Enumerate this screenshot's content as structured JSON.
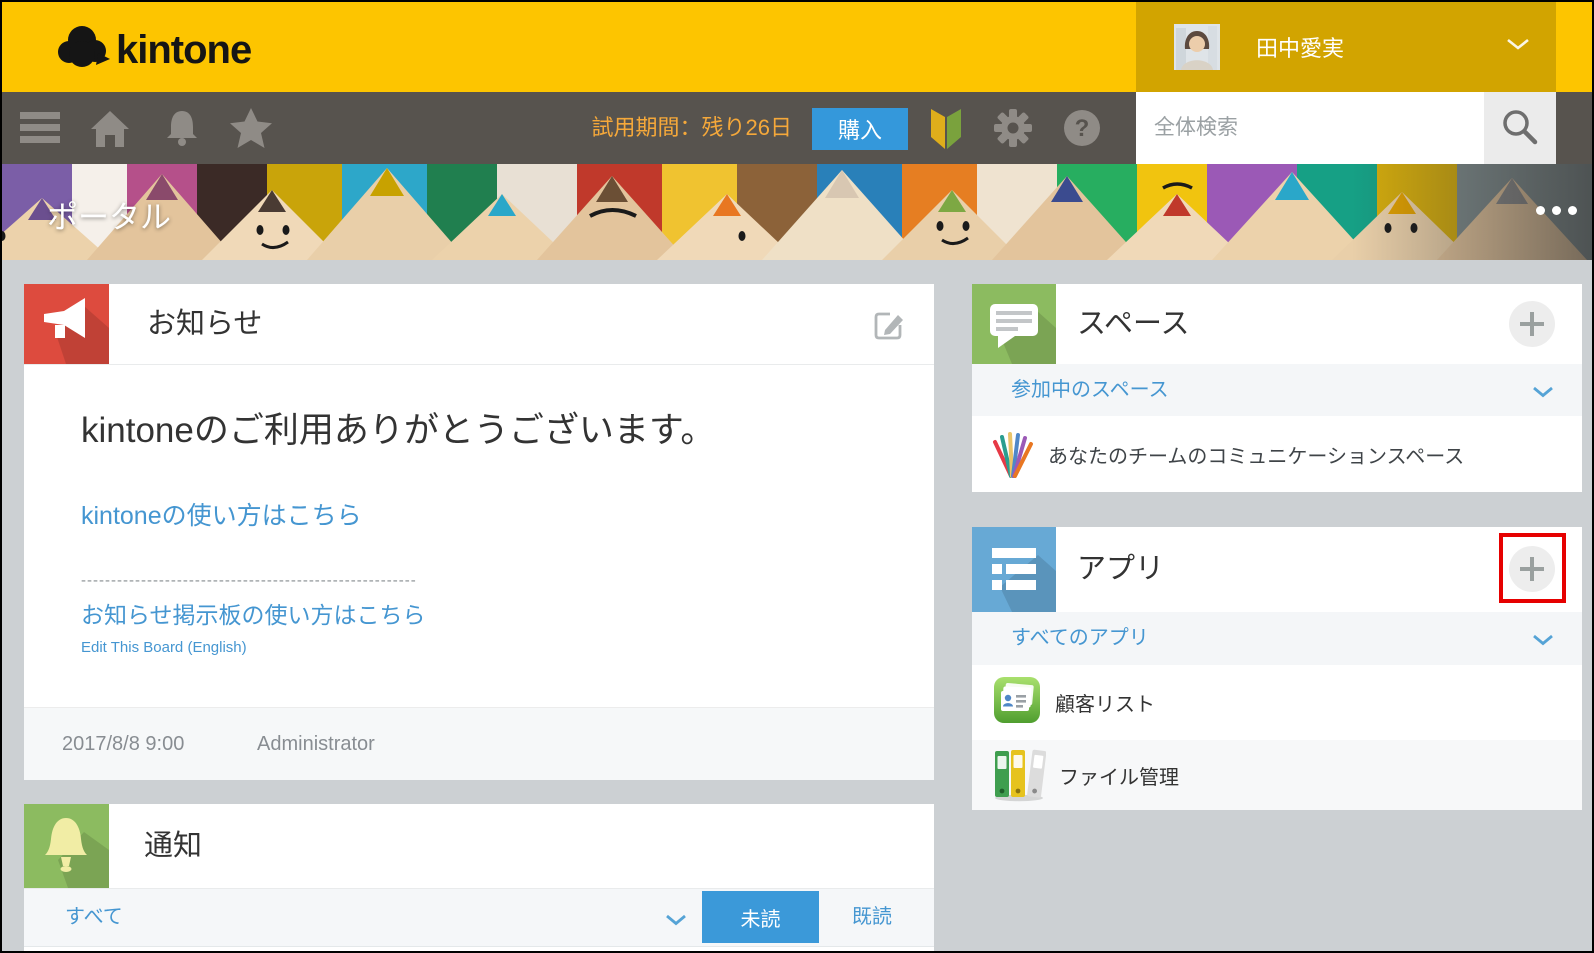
{
  "colors": {
    "brand_yellow": "#fdc500",
    "nav_gray": "#57534e",
    "trial_orange": "#f5a83a",
    "buy_blue": "#3498db",
    "link_blue": "#4596d1",
    "unread_blue": "#3b99d9",
    "announce_red": "#dd4b3e",
    "notice_green": "#8cbb60",
    "apps_blue": "#67a9d5",
    "highlight_red": "#e60000",
    "page_bg": "#ccd0d3"
  },
  "header": {
    "logo_text": "kintone",
    "user_name": "田中愛実"
  },
  "nav": {
    "trial_text": "試用期間：残り26日",
    "buy_label": "購入",
    "search_placeholder": "全体検索"
  },
  "cover": {
    "title": "ポータル"
  },
  "announcements": {
    "title": "お知らせ",
    "greeting": "kintoneのご利用ありがとうございます。",
    "link_usage": "kintoneの使い方はこちら",
    "divider": "--------------------------------------------------------",
    "link_board": "お知らせ掲示板の使い方はこちら",
    "link_edit_board": "Edit This Board (English)",
    "date": "2017/8/8 9:00",
    "author": "Administrator"
  },
  "notifications": {
    "title": "通知",
    "filter_all": "すべて",
    "unread_label": "未読",
    "read_label": "既読"
  },
  "spaces": {
    "title": "スペース",
    "group_label": "参加中のスペース",
    "items": [
      {
        "name": "あなたのチームのコミュニケーションスペース"
      }
    ]
  },
  "apps": {
    "title": "アプリ",
    "group_label": "すべてのアプリ",
    "items": [
      {
        "name": "顧客リスト"
      },
      {
        "name": "ファイル管理"
      }
    ]
  }
}
